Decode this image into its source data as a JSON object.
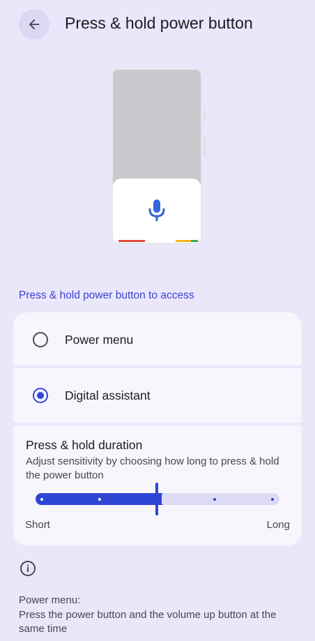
{
  "header": {
    "title": "Press & hold power button"
  },
  "illustration": {
    "assistant_icon": "microphone-icon",
    "colors": {
      "mic": "#2f66d8",
      "red": "#e24a3b",
      "yellow": "#f3b51c",
      "green": "#37a853"
    }
  },
  "access": {
    "section_label": "Press & hold power button to access",
    "options": [
      {
        "label": "Power menu",
        "selected": false
      },
      {
        "label": "Digital assistant",
        "selected": true
      }
    ]
  },
  "duration": {
    "title": "Press & hold duration",
    "description": "Adjust sensitivity by choosing how long to press & hold the power button",
    "slider": {
      "min_label": "Short",
      "max_label": "Long",
      "value_fraction": 0.5,
      "steps": 5
    }
  },
  "footer": {
    "info_icon": "info-icon",
    "title": "Power menu:",
    "text": "Press the power button and the volume up button at the same time"
  },
  "colors": {
    "accent": "#2f45d6",
    "background": "#ebe7fb",
    "card": "#f8f6fd",
    "section_label": "#3c3fd0"
  }
}
